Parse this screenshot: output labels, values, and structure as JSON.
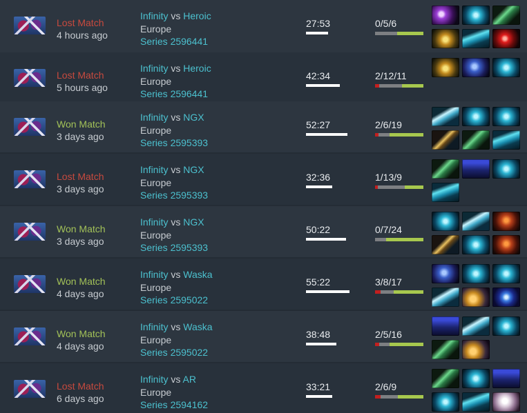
{
  "matches": [
    {
      "result": "Lost Match",
      "result_class": "lost",
      "ago": "4 hours ago",
      "team_a": "Infinity",
      "vs": "vs",
      "team_b": "Heroic",
      "region": "Europe",
      "series": "Series 2596441",
      "duration": "27:53",
      "duration_fraction": 0.51,
      "kda": "0/5/6",
      "kda_split": [
        0,
        5,
        6
      ],
      "items": [
        "purple-orb-item",
        "cyan-skull-item",
        "green-blade-item",
        "gold-relic-item",
        "frost-wave-item",
        "red-sphere-item"
      ]
    },
    {
      "result": "Lost Match",
      "result_class": "lost",
      "ago": "5 hours ago",
      "team_a": "Infinity",
      "vs": "vs",
      "team_b": "Heroic",
      "region": "Europe",
      "series": "Series 2596441",
      "duration": "42:34",
      "duration_fraction": 0.78,
      "kda": "2/12/11",
      "kda_split": [
        2,
        12,
        11
      ],
      "items": [
        "gold-relic-item",
        "blue-scepter-item",
        "cyan-skull-item"
      ]
    },
    {
      "result": "Won Match",
      "result_class": "won",
      "ago": "3 days ago",
      "team_a": "Infinity",
      "vs": "vs",
      "team_b": "NGX",
      "region": "Europe",
      "series": "Series 2595393",
      "duration": "52:27",
      "duration_fraction": 0.96,
      "kda": "2/6/19",
      "kda_split": [
        2,
        6,
        19
      ],
      "items": [
        "frost-axe-item",
        "cyan-skull-item",
        "cyan-skull-item",
        "gold-staff-item",
        "green-blade-item",
        "frost-wave-item"
      ]
    },
    {
      "result": "Lost Match",
      "result_class": "lost",
      "ago": "3 days ago",
      "team_a": "Infinity",
      "vs": "vs",
      "team_b": "NGX",
      "region": "Europe",
      "series": "Series 2595393",
      "duration": "32:36",
      "duration_fraction": 0.6,
      "kda": "1/13/9",
      "kda_split": [
        1,
        13,
        9
      ],
      "items": [
        "green-blade-item",
        "blue-cloak-item",
        "cyan-skull-item",
        "frost-wave-item"
      ]
    },
    {
      "result": "Won Match",
      "result_class": "won",
      "ago": "3 days ago",
      "team_a": "Infinity",
      "vs": "vs",
      "team_b": "NGX",
      "region": "Europe",
      "series": "Series 2595393",
      "duration": "50:22",
      "duration_fraction": 0.92,
      "kda": "0/7/24",
      "kda_split": [
        0,
        7,
        24
      ],
      "items": [
        "cyan-skull-item",
        "frost-axe-item",
        "red-armor-item",
        "gold-staff-item",
        "cyan-skull-item",
        "red-armor-item"
      ]
    },
    {
      "result": "Won Match",
      "result_class": "won",
      "ago": "4 days ago",
      "team_a": "Infinity",
      "vs": "vs",
      "team_b": "Waska",
      "region": "Europe",
      "series": "Series 2595022",
      "duration": "55:22",
      "duration_fraction": 1.0,
      "kda": "3/8/17",
      "kda_split": [
        3,
        8,
        17
      ],
      "items": [
        "blue-scepter-item",
        "cyan-skull-item",
        "cyan-skull-item",
        "frost-axe-item",
        "gold-gourd-item",
        "blue-orb-item"
      ]
    },
    {
      "result": "Won Match",
      "result_class": "won",
      "ago": "4 days ago",
      "team_a": "Infinity",
      "vs": "vs",
      "team_b": "Waska",
      "region": "Europe",
      "series": "Series 2595022",
      "duration": "38:48",
      "duration_fraction": 0.7,
      "kda": "2/5/16",
      "kda_split": [
        2,
        5,
        16
      ],
      "items": [
        "blue-cloak-item",
        "frost-axe-item",
        "cyan-skull-item",
        "green-blade-item",
        "gold-gourd-item"
      ]
    },
    {
      "result": "Lost Match",
      "result_class": "lost",
      "ago": "6 days ago",
      "team_a": "Infinity",
      "vs": "vs",
      "team_b": "AR",
      "region": "Europe",
      "series": "Series 2594162",
      "duration": "33:21",
      "duration_fraction": 0.61,
      "kda": "2/6/9",
      "kda_split": [
        2,
        6,
        9
      ],
      "items": [
        "green-blade-item",
        "cyan-skull-item",
        "blue-cloak-item",
        "cyan-skull-item",
        "frost-wave-item",
        "pearl-item"
      ]
    }
  ],
  "colors": {
    "lost": "#c94a3e",
    "won": "#a3c258",
    "link": "#4cc1cf",
    "kills": "#c21f1f",
    "assists": "#a7c84e",
    "deaths": "#7d7f82"
  }
}
